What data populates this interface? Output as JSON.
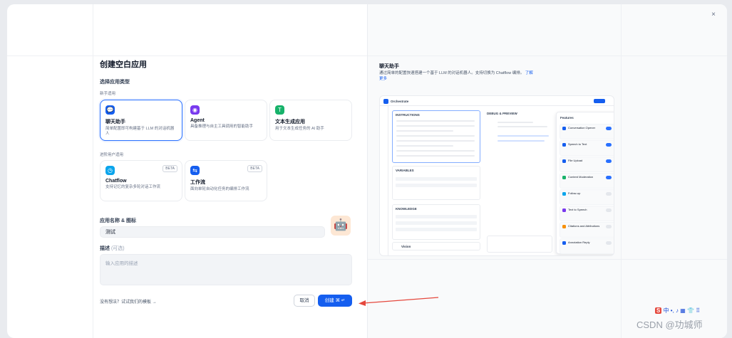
{
  "dialog": {
    "title": "创建空白应用",
    "close_icon": "×",
    "app_type_label": "选择应用类型",
    "beginner_label": "新手适用",
    "advanced_label": "进阶用户适用",
    "types": [
      {
        "icon": "💬",
        "icon_color": "#155eef",
        "name": "聊天助手",
        "desc": "简单配置即可构建基于 LLM 的对话机器人",
        "selected": true
      },
      {
        "icon": "◉",
        "icon_color": "#7839ee",
        "name": "Agent",
        "desc": "具备推理与自主工具调用的智能助手",
        "selected": false
      },
      {
        "icon": "T",
        "icon_color": "#17b26a",
        "name": "文本生成应用",
        "desc": "用于文本生成任务的 AI 助手",
        "selected": false
      }
    ],
    "advanced_types": [
      {
        "icon": "◷",
        "icon_color": "#0ba5ec",
        "name": "Chatflow",
        "desc": "支持记忆的复杂多轮对话工作流",
        "beta": "BETA"
      },
      {
        "icon": "⇆",
        "icon_color": "#155eef",
        "name": "工作流",
        "desc": "面向单轮自动化任务的编排工作流",
        "beta": "BETA"
      }
    ],
    "name_label": "应用名称 & 图标",
    "name_value": "测试",
    "avatar_icon": "🤖",
    "desc_label": "描述",
    "desc_optional": "(可选)",
    "desc_placeholder": "输入应用的描述",
    "template_link": "没有想法？试试我们的模板 →",
    "cancel_label": "取消",
    "create_label": "创建 ⌘ ↵"
  },
  "preview": {
    "title": "聊天助手",
    "desc": "通过简单的配置快速搭建一个基于 LLM 的对话机器人。支持切换为 Chatflow 编排。",
    "more_link": "了解更多",
    "shot": {
      "app_name": "Orchestrate",
      "instructions": "INSTRUCTIONS",
      "debug": "DEBUG & PREVIEW",
      "variables": "VARIABLES",
      "knowledge": "KNOWLEDGE",
      "vision": "Vision",
      "features_title": "Features",
      "features": [
        {
          "name": "Conversation Opener",
          "on": true,
          "color": "#155eef"
        },
        {
          "name": "Speech to Text",
          "on": true,
          "color": "#155eef"
        },
        {
          "name": "File Upload",
          "on": true,
          "color": "#155eef"
        },
        {
          "name": "Content Moderation",
          "on": true,
          "color": "#17b26a"
        },
        {
          "name": "Follow-up",
          "on": false,
          "color": "#0ba5ec"
        },
        {
          "name": "Text to Speech",
          "on": false,
          "color": "#7839ee"
        },
        {
          "name": "Citations and Attributions",
          "on": false,
          "color": "#f79009"
        },
        {
          "name": "Annotation Reply",
          "on": false,
          "color": "#155eef"
        }
      ]
    }
  },
  "ime": {
    "logo": "S",
    "text": "中 •, ♪ ▦ 👕 ⠿"
  },
  "watermark": "CSDN @功城师",
  "colors": {
    "accent": "#155eef",
    "arrow": "#e5483d"
  }
}
